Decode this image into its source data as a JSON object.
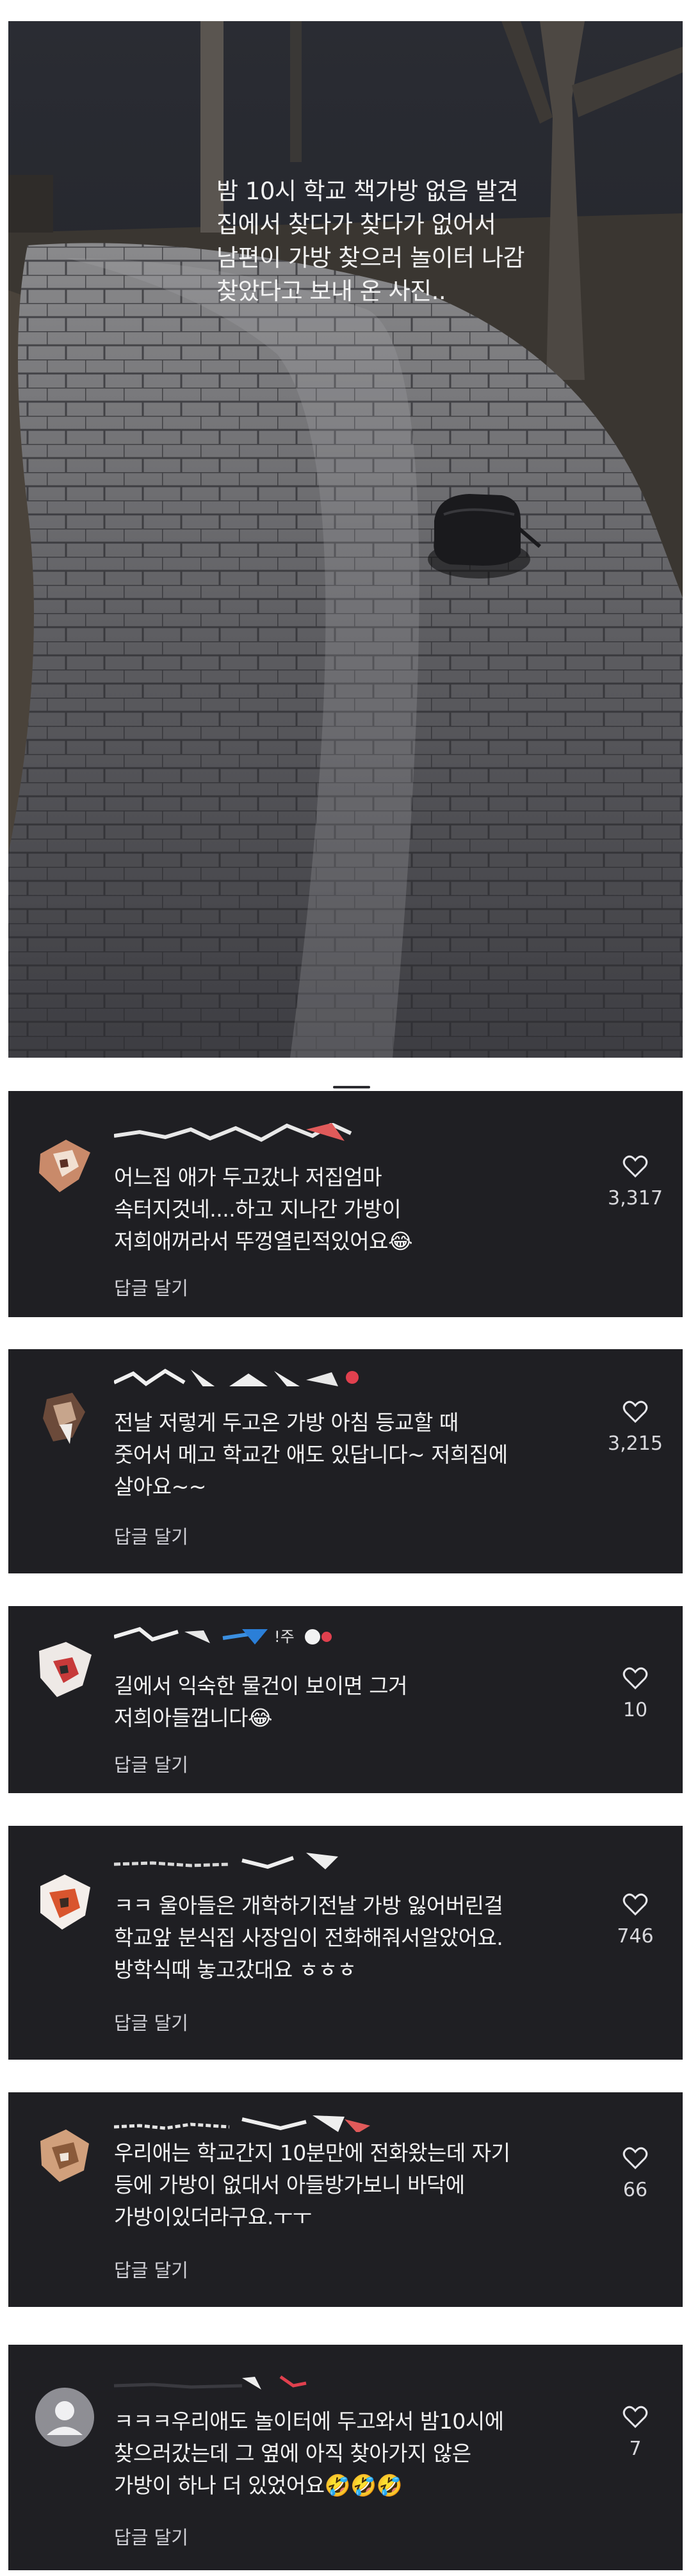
{
  "photo": {
    "caption_lines": [
      "밤 10시 학교 책가방 없음 발견",
      "집에서 찾다가 찾다가 없어서",
      "남편이 가방 찾으러 놀이터 나감",
      "찾았다고 보내 온 사진.."
    ]
  },
  "comments": [
    {
      "lines": [
        "어느집 애가 두고갔나 저집엄마",
        "속터지것네....하고 지나간 가방이",
        "저희애꺼라서 뚜껑열린적있어요😂"
      ],
      "reply_label": "답글 달기",
      "likes": "3,317",
      "icon": "heart-outline-icon"
    },
    {
      "lines": [
        "전날 저렇게 두고온 가방 아침 등교할 때",
        "줏어서 메고 학교간 애도 있답니다~ 저희집에",
        "살아요~~"
      ],
      "reply_label": "답글 달기",
      "likes": "3,215",
      "icon": "heart-outline-icon"
    },
    {
      "lines": [
        "길에서 익숙한 물건이 보이면 그거",
        "저희아들껍니다😂"
      ],
      "reply_label": "답글 달기",
      "likes": "10",
      "icon": "heart-outline-icon"
    },
    {
      "lines": [
        "ㅋㅋ 울아들은 개학하기전날 가방 잃어버린걸",
        "학교앞 분식집 사장임이 전화해줘서알았어요.",
        "방학식때 놓고갔대요 ㅎㅎㅎ"
      ],
      "reply_label": "답글 달기",
      "likes": "746",
      "icon": "heart-outline-icon"
    },
    {
      "lines": [
        "우리애는 학교간지 10분만에 전화왔는데 자기",
        "등에 가방이 없대서 아들방가보니 바닥에",
        "가방이있더라구요.ㅜㅜ"
      ],
      "reply_label": "답글 달기",
      "likes": "66",
      "icon": "heart-outline-icon"
    },
    {
      "lines": [
        "ㅋㅋㅋ우리애도 놀이터에 두고와서 밤10시에",
        "찾으러갔는데 그 옆에 아직 찾아가지 않은",
        "가방이 하나 더 있었어요🤣🤣🤣"
      ],
      "reply_label": "답글 달기",
      "likes": "7",
      "icon": "heart-outline-icon"
    }
  ]
}
